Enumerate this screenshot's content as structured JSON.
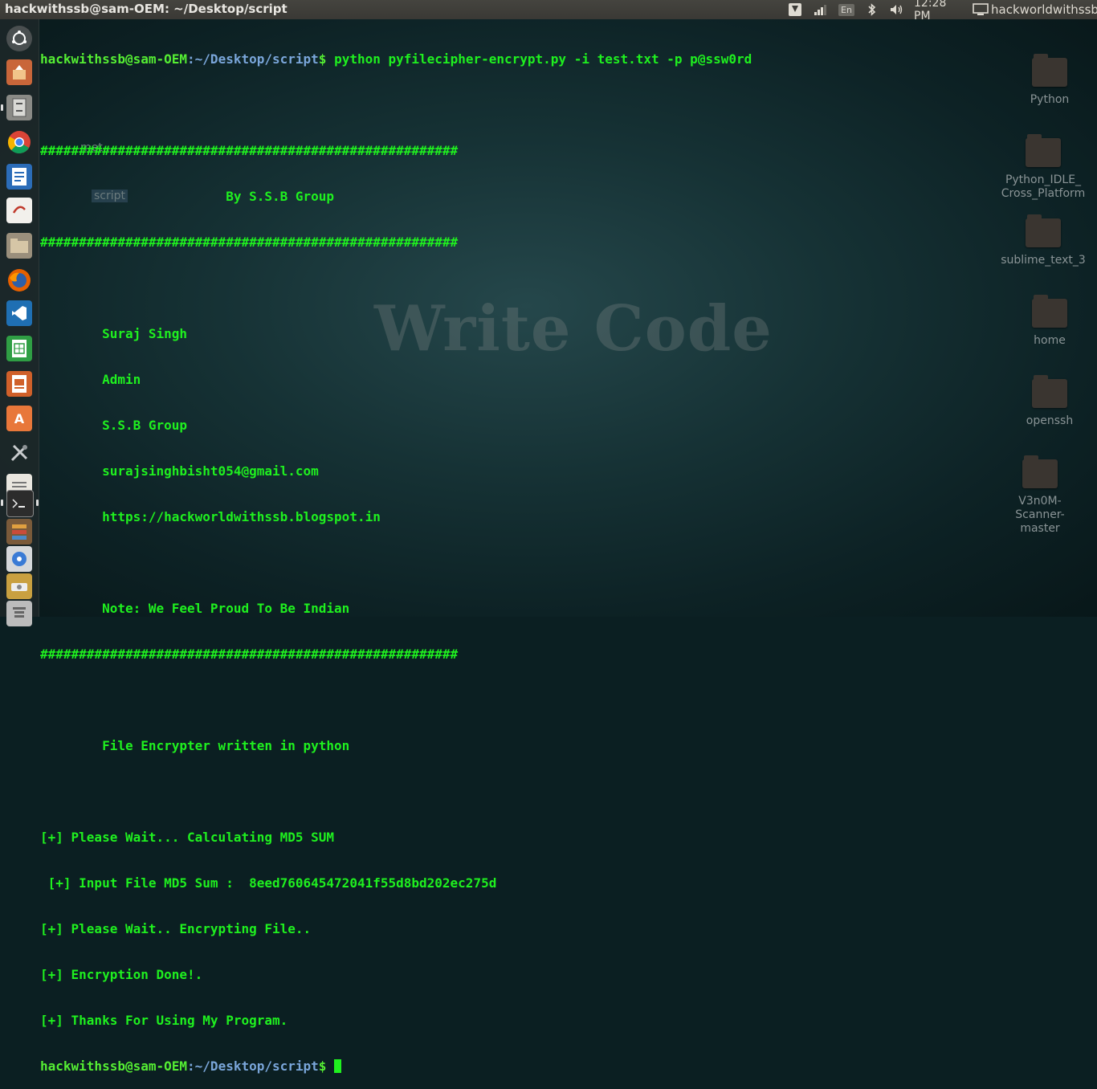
{
  "topbar": {
    "window_title": "hackwithssb@sam-OEM: ~/Desktop/script",
    "lang": "En",
    "clock": "12:28 PM",
    "username": "hackworldwithssb"
  },
  "desktop": {
    "watermark": "Write Code",
    "icons": [
      "Python",
      "Python_IDLE_\nCross_Platform",
      "sublime_text_3",
      "home",
      "openssh",
      "V3n0M-Scanner-\nmaster"
    ],
    "ghost_labels": [
      "met...",
      "script"
    ]
  },
  "terminal": {
    "prompt_user": "hackwithssb@sam-OEM",
    "prompt_path": ":~/Desktop/script",
    "prompt_symbol": "$",
    "command": " python pyfilecipher-encrypt.py -i test.txt -p p@ssw0rd",
    "lines": [
      "",
      "######################################################",
      "                        By S.S.B Group",
      "######################################################",
      "",
      "        Suraj Singh",
      "        Admin",
      "        S.S.B Group",
      "        surajsinghbisht054@gmail.com",
      "        https://hackworldwithssb.blogspot.in",
      "",
      "        Note: We Feel Proud To Be Indian",
      "######################################################",
      "",
      "        File Encrypter written in python",
      "",
      "[+] Please Wait... Calculating MD5 SUM",
      " [+] Input File MD5 Sum :  8eed760645472041f55d8bd202ec275d",
      "[+] Please Wait.. Encrypting File..",
      "[+] Encryption Done!.",
      "[+] Thanks For Using My Program."
    ]
  },
  "colors": {
    "terminal_green": "#1ff01f",
    "prompt_path_blue": "#7aa6da"
  }
}
